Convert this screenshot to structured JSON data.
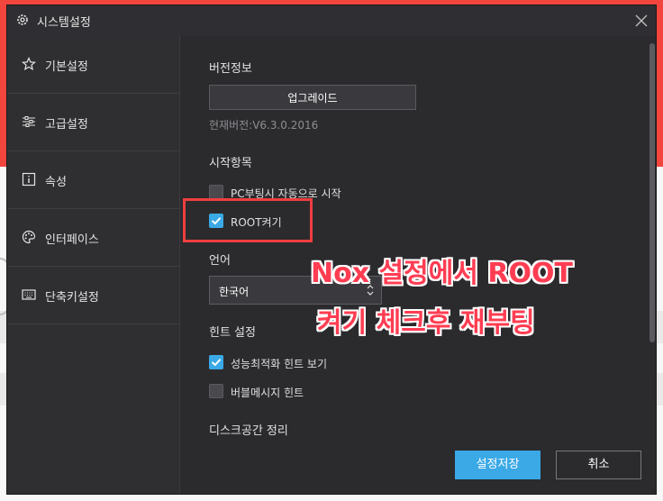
{
  "window": {
    "title": "시스템설정"
  },
  "sidebar": {
    "items": [
      {
        "label": "기본설정",
        "icon": "star-icon"
      },
      {
        "label": "고급설정",
        "icon": "sliders-icon"
      },
      {
        "label": "속성",
        "icon": "info-icon"
      },
      {
        "label": "인터페이스",
        "icon": "palette-icon"
      },
      {
        "label": "단축키설정",
        "icon": "keyboard-icon"
      }
    ]
  },
  "content": {
    "version_section": {
      "title": "버전정보",
      "upgrade_label": "업그레이드",
      "current_version": "현재버전:V6.3.0.2016"
    },
    "startup_section": {
      "title": "시작항목",
      "auto_start": {
        "label": "PC부팅시 자동으로 시작",
        "checked": false
      },
      "root": {
        "label": "ROOT켜기",
        "checked": true
      }
    },
    "language_section": {
      "title": "언어",
      "selected": "한국어"
    },
    "hint_section": {
      "title": "힌트 설정",
      "perf_hint": {
        "label": "성능최적화 힌트 보기",
        "checked": true
      },
      "bubble_hint": {
        "label": "버블메시지 힌트",
        "checked": false
      }
    },
    "disk_section": {
      "title": "디스크공간 정리"
    }
  },
  "footer": {
    "save_label": "설정저장",
    "cancel_label": "취소"
  },
  "annotation": {
    "line1": "Nox 설정에서 ROOT",
    "line2": "켜기 체크후 재부팅"
  },
  "colors": {
    "accent": "#3aa9e6",
    "annotation": "#ff3d52",
    "highlight": "#ef3e3e",
    "background_red": "#f2453d"
  }
}
